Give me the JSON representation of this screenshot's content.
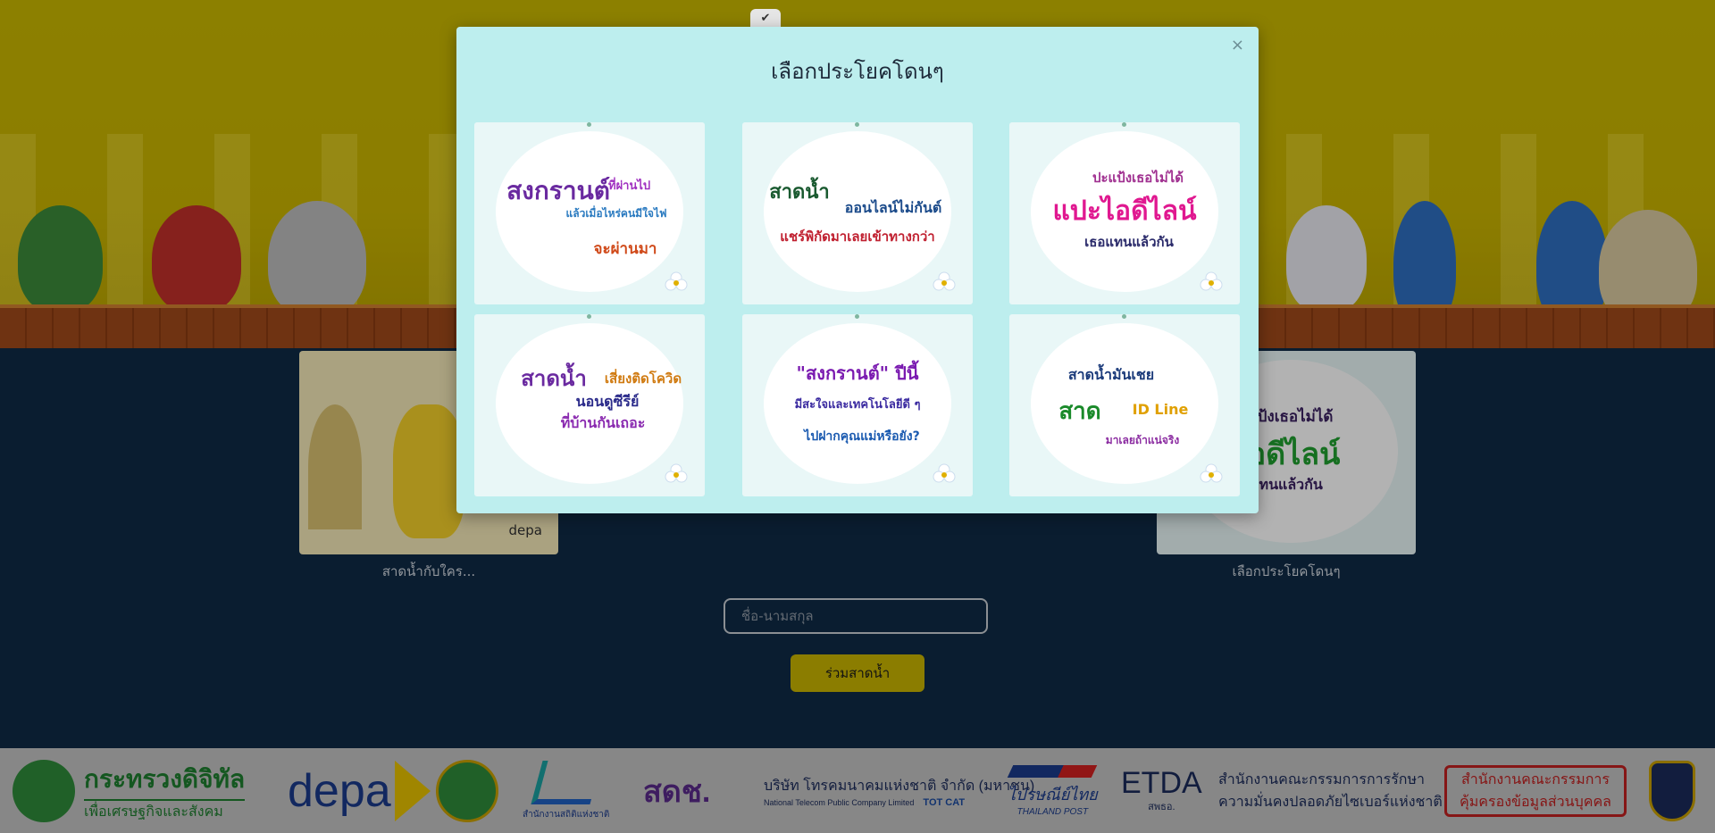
{
  "modal": {
    "title": "เลือกประโยคโดนๆ",
    "close_label": "×",
    "options": [
      {
        "lines": [
          "สงกรานต์",
          "ที่ผ่านไป",
          "แล้วเมื่อไหร่คนมีใจไฟ",
          "จะผ่านมา"
        ]
      },
      {
        "lines": [
          "สาดน้ำ",
          "ออนไลน์ไม่กันต์",
          "แชร์พิกัดมาเลยเข้าทางกว่า"
        ]
      },
      {
        "lines": [
          "ปะแป้งเธอไม่ได้",
          "แปะไอดีไลน์",
          "เธอแทนแล้วกัน"
        ]
      },
      {
        "lines": [
          "สาดน้ำ",
          "เสี่ยงติดโควิด",
          "นอนดูซีรีย์",
          "ที่บ้านกันเถอะ"
        ]
      },
      {
        "lines": [
          "\"สงกรานต์\" ปีนี้",
          "มีสะใจและเทคโนโลยีดี ๆ",
          "ไปฝากคุณแม่หรือยัง?"
        ]
      },
      {
        "lines": [
          "สาดน้ำมันเชย",
          "สาด",
          "ID Line",
          "มาเลยถ้าแน่จริง"
        ]
      }
    ]
  },
  "page": {
    "left_caption": "สาดน้ำกับใคร...",
    "right_caption": "เลือกประโยคโดนๆ",
    "right_card_lines": [
      "ะแป้งเธอไม่ได้",
      "ไอดีไลน์",
      "แทนแล้วกัน"
    ],
    "left_card_brand": "depa",
    "name_placeholder": "ชื่อ-นามสกุล",
    "submit_label": "ร่วมสาดน้ำ",
    "tab_icon": "✔"
  },
  "footer": {
    "logos": [
      {
        "name": "กระทรวงดิจิทัล",
        "sub": "เพื่อเศรษฐกิจและสังคม"
      },
      {
        "name": "depa"
      },
      {
        "name": "สำนักงานสถิติแห่งชาติ"
      },
      {
        "name": "สดช."
      },
      {
        "name": "บริษัท โทรคมนาคมแห่งชาติ จำกัด (มหาชน)",
        "sub": "National Telecom Public Company Limited",
        "brands": "TOT CAT"
      },
      {
        "name": "ไปรษณีย์ไทย",
        "sub": "THAILAND POST"
      },
      {
        "name": "ETDA",
        "sub": "สพธอ."
      },
      {
        "name": "สำนักงานคณะกรรมการการรักษา",
        "sub": "ความมั่นคงปลอดภัยไซเบอร์แห่งชาติ"
      },
      {
        "name": "สำนักงานคณะกรรมการ",
        "sub": "คุ้มครองข้อมูลส่วนบุคคล"
      }
    ]
  },
  "colors": {
    "banner": "#c9b800",
    "page_bg": "#0f2a45",
    "modal_bg": "#bdeeee",
    "button": "#c8b400",
    "footer": "#c2c2c2"
  }
}
